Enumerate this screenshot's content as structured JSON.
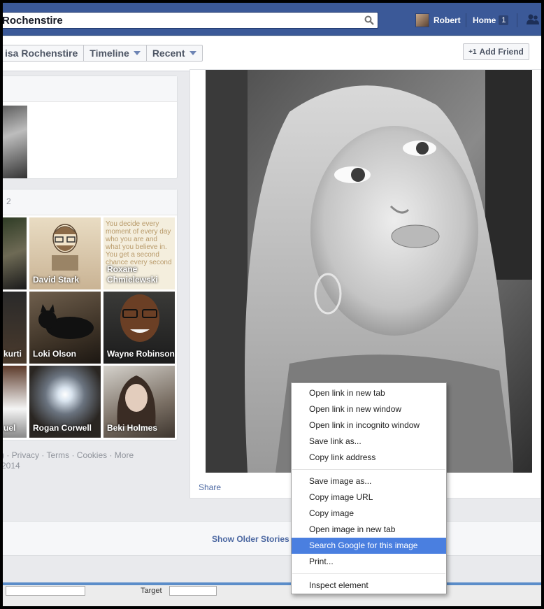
{
  "header": {
    "search_value": "Rochenstire",
    "user_name": "Robert",
    "home_label": "Home",
    "home_count": "1"
  },
  "profile_nav": {
    "name_crumb": "isa Rochenstire",
    "timeline_label": "Timeline",
    "recent_label": "Recent",
    "add_friend_label": "Add Friend",
    "add_friend_icon": "+1"
  },
  "friends_card": {
    "count_fragment": "2",
    "friends": [
      {
        "name": ""
      },
      {
        "name": "David Stark"
      },
      {
        "name": "Roxane Chmielewski"
      },
      {
        "name": "kurti"
      },
      {
        "name": "Loki Olson"
      },
      {
        "name": "Wayne Robinson"
      },
      {
        "name": "uel"
      },
      {
        "name": "Rogan Corwell"
      },
      {
        "name": "Beki Holmes"
      }
    ],
    "tile_quote": "You decide every moment of every day who you are and what you believe in. You get a second chance every second"
  },
  "footer": {
    "links": ") · Privacy · Terms · Cookies · More",
    "copyright": "2014"
  },
  "photo": {
    "share_label": "Share"
  },
  "stream": {
    "show_older": "Show Older Stories"
  },
  "bottom_toolbar": {
    "target_label": "Target"
  },
  "context_menu": {
    "group1": [
      "Open link in new tab",
      "Open link in new window",
      "Open link in incognito window",
      "Save link as...",
      "Copy link address"
    ],
    "group2": [
      "Save image as...",
      "Copy image URL",
      "Copy image",
      "Open image in new tab",
      "Search Google for this image",
      "Print..."
    ],
    "group3": [
      "Inspect element"
    ],
    "active_item": "Search Google for this image"
  },
  "colors": {
    "brand_blue": "#3b5998",
    "link_blue": "#4b67a1",
    "menu_highlight": "#4a7fe0"
  }
}
